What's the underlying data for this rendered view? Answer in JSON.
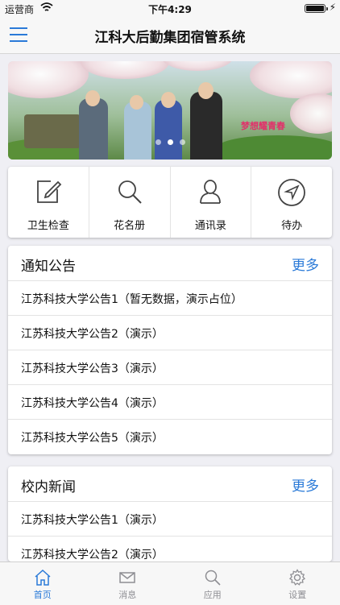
{
  "status_bar": {
    "carrier": "运营商",
    "time": "下午4:29",
    "battery_level": 1.0
  },
  "nav": {
    "title": "江科大后勤集团宿管系统",
    "menu_icon": "hamburger-icon"
  },
  "banner": {
    "slogan": "梦想耀青春",
    "pages": 3,
    "active_page": 1
  },
  "quick_actions": [
    {
      "label": "卫生检查",
      "icon": "edit-icon"
    },
    {
      "label": "花名册",
      "icon": "search-icon"
    },
    {
      "label": "通讯录",
      "icon": "person-icon"
    },
    {
      "label": "待办",
      "icon": "navigation-icon"
    }
  ],
  "notices": {
    "title": "通知公告",
    "more": "更多",
    "items": [
      "江苏科技大学公告1（暂无数据，演示占位）",
      "江苏科技大学公告2（演示）",
      "江苏科技大学公告3（演示）",
      "江苏科技大学公告4（演示）",
      "江苏科技大学公告5（演示）"
    ]
  },
  "news": {
    "title": "校内新闻",
    "more": "更多",
    "items": [
      "江苏科技大学公告1（演示）",
      "江苏科技大学公告2（演示）"
    ]
  },
  "tabbar": [
    {
      "label": "首页",
      "icon": "home-icon",
      "active": true
    },
    {
      "label": "消息",
      "icon": "mail-icon",
      "active": false
    },
    {
      "label": "应用",
      "icon": "search-icon",
      "active": false
    },
    {
      "label": "设置",
      "icon": "gear-icon",
      "active": false
    }
  ],
  "colors": {
    "accent": "#2a7ad8",
    "background": "#efeff4",
    "inactive": "#8e8e93"
  }
}
